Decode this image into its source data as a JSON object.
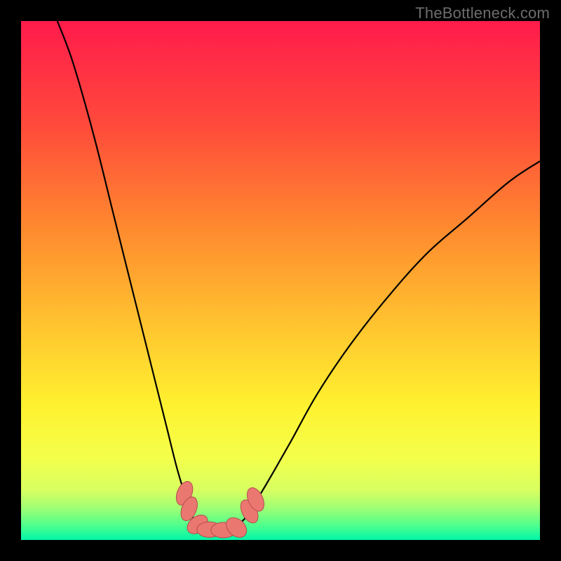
{
  "watermark": {
    "text": "TheBottleneck.com"
  },
  "colors": {
    "frame": "#000000",
    "curve": "#000000",
    "marker_fill": "#eb7771",
    "marker_stroke": "#b34d4d",
    "gradient_stops": [
      {
        "offset": 0.0,
        "color": "#ff1b4b"
      },
      {
        "offset": 0.2,
        "color": "#ff4a3b"
      },
      {
        "offset": 0.4,
        "color": "#ff8a2f"
      },
      {
        "offset": 0.58,
        "color": "#ffc22f"
      },
      {
        "offset": 0.74,
        "color": "#fff12f"
      },
      {
        "offset": 0.84,
        "color": "#f4ff4a"
      },
      {
        "offset": 0.905,
        "color": "#d7ff61"
      },
      {
        "offset": 0.94,
        "color": "#9cff75"
      },
      {
        "offset": 0.972,
        "color": "#4fff8d"
      },
      {
        "offset": 1.0,
        "color": "#00f5a8"
      }
    ]
  },
  "chart_data": {
    "type": "line",
    "title": "",
    "xlabel": "",
    "ylabel": "",
    "xlim": [
      0,
      100
    ],
    "ylim": [
      0,
      100
    ],
    "grid": false,
    "legend_position": "none",
    "curve": [
      {
        "x": 7,
        "y": 100
      },
      {
        "x": 10,
        "y": 92
      },
      {
        "x": 14,
        "y": 78
      },
      {
        "x": 18,
        "y": 62
      },
      {
        "x": 22,
        "y": 46
      },
      {
        "x": 26,
        "y": 30
      },
      {
        "x": 28,
        "y": 22
      },
      {
        "x": 30,
        "y": 14
      },
      {
        "x": 31.5,
        "y": 9
      },
      {
        "x": 33,
        "y": 4.5
      },
      {
        "x": 35,
        "y": 2.4
      },
      {
        "x": 37,
        "y": 2.0
      },
      {
        "x": 39,
        "y": 2.0
      },
      {
        "x": 41,
        "y": 2.4
      },
      {
        "x": 43,
        "y": 4.0
      },
      {
        "x": 45,
        "y": 7.0
      },
      {
        "x": 48,
        "y": 12
      },
      {
        "x": 52,
        "y": 19
      },
      {
        "x": 57,
        "y": 28
      },
      {
        "x": 63,
        "y": 37
      },
      {
        "x": 70,
        "y": 46
      },
      {
        "x": 78,
        "y": 55
      },
      {
        "x": 86,
        "y": 62
      },
      {
        "x": 94,
        "y": 69
      },
      {
        "x": 100,
        "y": 73
      }
    ],
    "markers": [
      {
        "x": 31.5,
        "y": 9.0,
        "rx": 1.4,
        "ry": 2.4,
        "rot": 22
      },
      {
        "x": 32.4,
        "y": 6.0,
        "rx": 1.4,
        "ry": 2.4,
        "rot": 22
      },
      {
        "x": 34.0,
        "y": 3.0,
        "rx": 1.5,
        "ry": 2.2,
        "rot": 52
      },
      {
        "x": 36.3,
        "y": 2.0,
        "rx": 2.4,
        "ry": 1.5,
        "rot": 0
      },
      {
        "x": 39.0,
        "y": 1.9,
        "rx": 2.4,
        "ry": 1.5,
        "rot": 0
      },
      {
        "x": 41.5,
        "y": 2.4,
        "rx": 1.6,
        "ry": 2.2,
        "rot": -48
      },
      {
        "x": 44.0,
        "y": 5.5,
        "rx": 1.4,
        "ry": 2.4,
        "rot": -28
      },
      {
        "x": 45.2,
        "y": 7.8,
        "rx": 1.4,
        "ry": 2.4,
        "rot": -25
      }
    ]
  }
}
